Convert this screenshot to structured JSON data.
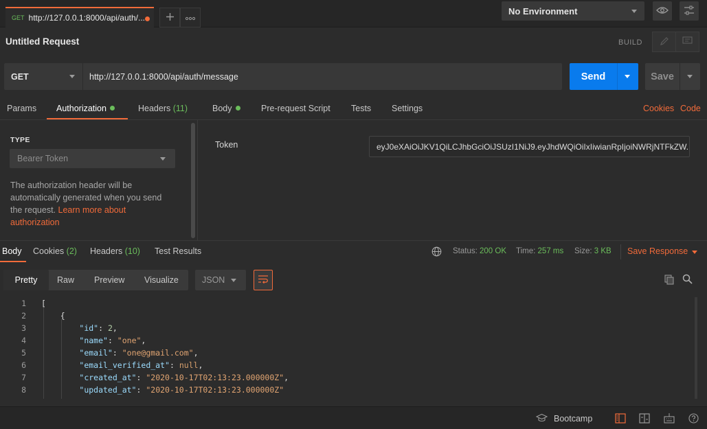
{
  "tabbar": {
    "tab": {
      "method": "GET",
      "url": "http://127.0.0.1:8000/api/auth/..."
    },
    "environment": "No Environment",
    "icons": [
      "plus-icon",
      "more-icon",
      "eye-icon",
      "sliders-icon"
    ]
  },
  "request": {
    "title": "Untitled Request",
    "build_label": "BUILD",
    "method": "GET",
    "url": "http://127.0.0.1:8000/api/auth/message",
    "send_label": "Send",
    "save_label": "Save"
  },
  "request_tabs": {
    "params": "Params",
    "authorization": "Authorization",
    "headers": "Headers",
    "headers_count": "(11)",
    "body": "Body",
    "prerequest": "Pre-request Script",
    "tests": "Tests",
    "settings": "Settings",
    "cookies": "Cookies",
    "code": "Code"
  },
  "auth": {
    "type_label": "TYPE",
    "type_value": "Bearer Token",
    "help_text": "The authorization header will be automatically generated when you send the request.",
    "help_link": "Learn more about authorization",
    "token_label": "Token",
    "token_value": "eyJ0eXAiOiJKV1QiLCJhbGciOiJSUzI1NiJ9.eyJhdWQiOiIxIiwianRpIjoiNWRjNTFkZW..."
  },
  "response_tabs": {
    "body": "Body",
    "cookies": "Cookies",
    "cookies_count": "(2)",
    "headers": "Headers",
    "headers_count": "(10)",
    "test_results": "Test Results"
  },
  "response_meta": {
    "status_label": "Status:",
    "status_value": "200 OK",
    "time_label": "Time:",
    "time_value": "257 ms",
    "size_label": "Size:",
    "size_value": "3 KB",
    "save_response": "Save Response"
  },
  "view": {
    "pretty": "Pretty",
    "raw": "Raw",
    "preview": "Preview",
    "visualize": "Visualize",
    "format": "JSON"
  },
  "code_lines": [
    {
      "n": "1",
      "text": "["
    },
    {
      "n": "2",
      "text": "    {"
    },
    {
      "n": "3",
      "key": "\"id\"",
      "value": "2",
      "vtype": "num",
      "comma": ","
    },
    {
      "n": "4",
      "key": "\"name\"",
      "value": "\"one\"",
      "vtype": "str",
      "comma": ","
    },
    {
      "n": "5",
      "key": "\"email\"",
      "value": "\"one@gmail.com\"",
      "vtype": "str",
      "comma": ","
    },
    {
      "n": "6",
      "key": "\"email_verified_at\"",
      "value": "null",
      "vtype": "nul",
      "comma": ","
    },
    {
      "n": "7",
      "key": "\"created_at\"",
      "value": "\"2020-10-17T02:13:23.000000Z\"",
      "vtype": "str",
      "comma": ","
    },
    {
      "n": "8",
      "key": "\"updated_at\"",
      "value": "\"2020-10-17T02:13:23.000000Z\"",
      "vtype": "str",
      "comma": ""
    }
  ],
  "statusbar": {
    "bootcamp": "Bootcamp"
  }
}
